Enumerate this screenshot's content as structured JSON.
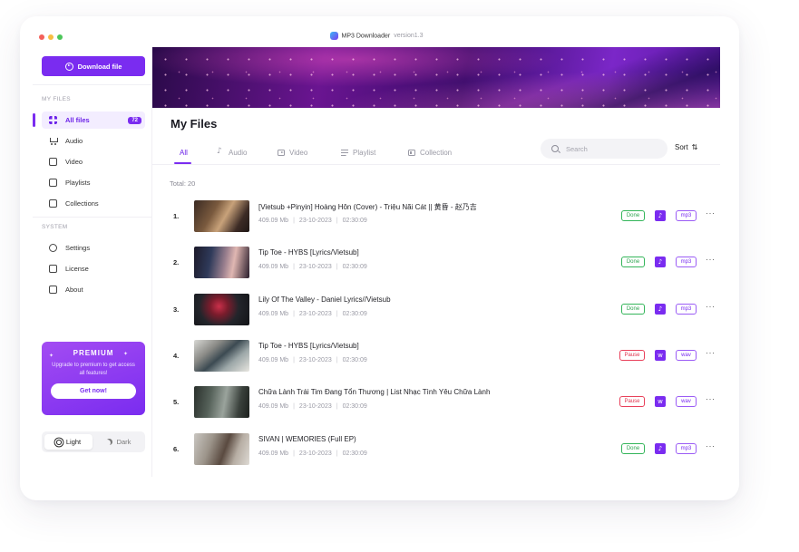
{
  "app": {
    "title": "MP3 Downloader",
    "version": "version1.3"
  },
  "sidebar": {
    "download_label": "Download file",
    "my_files_heading": "MY FILES",
    "system_heading": "SYSTEM",
    "items": [
      {
        "label": "All files",
        "count": "72"
      },
      {
        "label": "Audio"
      },
      {
        "label": "Video"
      },
      {
        "label": "Playlists"
      },
      {
        "label": "Collections"
      }
    ],
    "system_items": [
      {
        "label": "Settings"
      },
      {
        "label": "License"
      },
      {
        "label": "About"
      }
    ],
    "premium": {
      "title": "PREMIUM",
      "text": "Upgrade to premium to get access all features!",
      "button": "Get now!"
    },
    "theme": {
      "light": "Light",
      "dark": "Dark"
    }
  },
  "main": {
    "title": "My Files",
    "tabs": [
      {
        "label": "All"
      },
      {
        "label": "Audio"
      },
      {
        "label": "Video"
      },
      {
        "label": "Playlist"
      },
      {
        "label": "Collection"
      }
    ],
    "search_placeholder": "Search",
    "sort_label": "Sort",
    "total": "Total: 20",
    "rows": [
      {
        "num": "1.",
        "title": "[Vietsub +Pinyin] Hoàng Hôn (Cover) - Triệu Nãi Cát || 黄昏 - 赵乃吉",
        "size": "409.09 Mb",
        "date": "23-10-2023",
        "duration": "02:30:09",
        "status": "Done",
        "type": "mp3"
      },
      {
        "num": "2.",
        "title": "Tip Toe - HYBS [Lyrics/Vietsub]",
        "size": "409.09 Mb",
        "date": "23-10-2023",
        "duration": "02:30:09",
        "status": "Done",
        "type": "mp3"
      },
      {
        "num": "3.",
        "title": "Lily Of The Valley - Daniel Lyrics//Vietsub",
        "size": "409.09 Mb",
        "date": "23-10-2023",
        "duration": "02:30:09",
        "status": "Done",
        "type": "mp3"
      },
      {
        "num": "4.",
        "title": "Tip Toe - HYBS [Lyrics/Vietsub]",
        "size": "409.09 Mb",
        "date": "23-10-2023",
        "duration": "02:30:09",
        "status": "Pause",
        "type": "wav"
      },
      {
        "num": "5.",
        "title": "Chữa Lành Trái Tim Đang Tổn Thương | List Nhạc Tình Yêu Chữa Lành",
        "size": "409.09 Mb",
        "date": "23-10-2023",
        "duration": "02:30:09",
        "status": "Pause",
        "type": "wav"
      },
      {
        "num": "6.",
        "title": "SIVAN | WEMORIES (Full EP)",
        "size": "409.09 Mb",
        "date": "23-10-2023",
        "duration": "02:30:09",
        "status": "Done",
        "type": "mp3"
      }
    ]
  },
  "colors": {
    "accent": "#7a2cf0",
    "done": "#2ea650",
    "pause": "#e0334d"
  }
}
